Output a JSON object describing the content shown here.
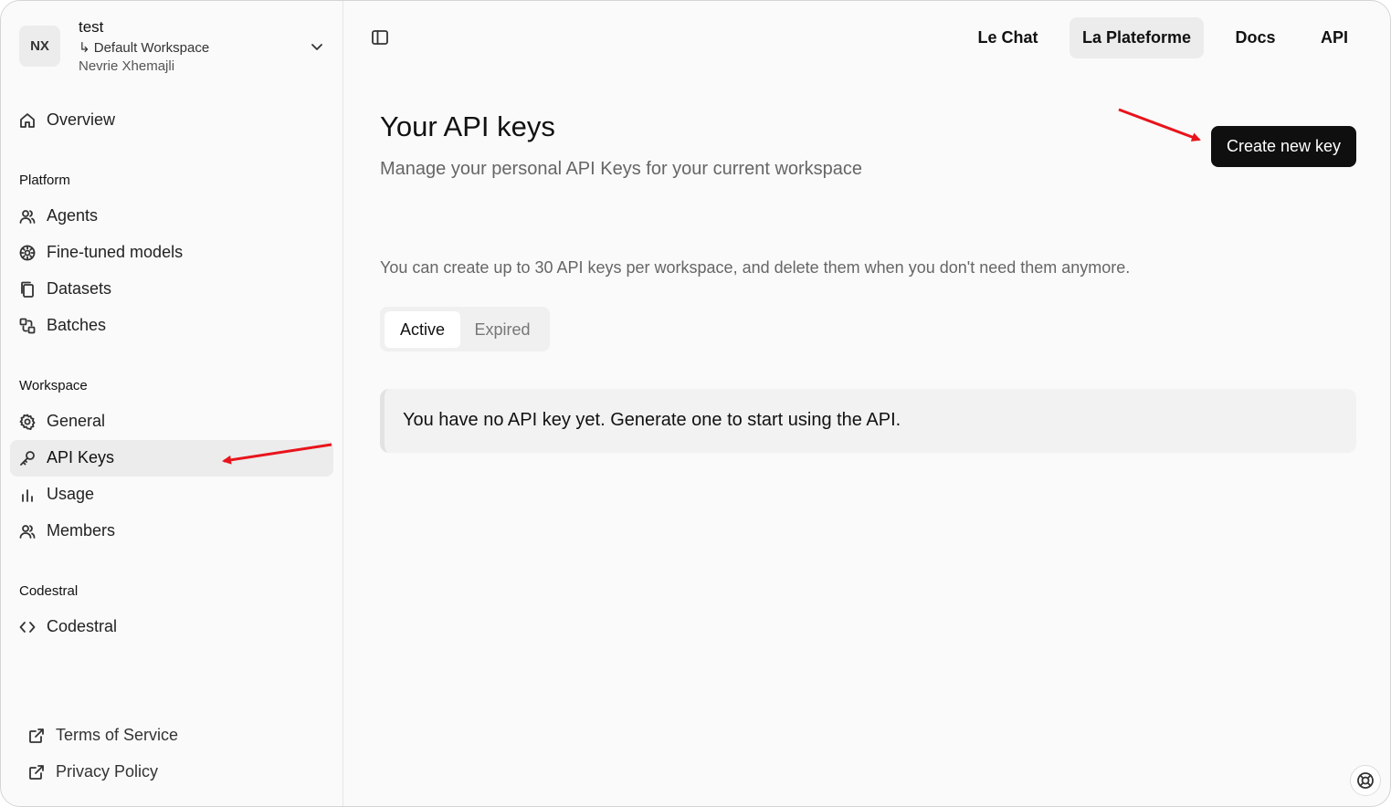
{
  "workspace": {
    "initials": "NX",
    "name": "test",
    "subtitle": "↳ Default Workspace",
    "user": "Nevrie Xhemajli"
  },
  "sidebar": {
    "overview": "Overview",
    "platform_label": "Platform",
    "platform_items": [
      "Agents",
      "Fine-tuned models",
      "Datasets",
      "Batches"
    ],
    "workspace_label": "Workspace",
    "workspace_items": [
      "General",
      "API Keys",
      "Usage",
      "Members"
    ],
    "codestral_label": "Codestral",
    "codestral_items": [
      "Codestral"
    ],
    "footer_items": [
      "Terms of Service",
      "Privacy Policy"
    ],
    "active_item": "API Keys"
  },
  "topnav": {
    "items": [
      "Le Chat",
      "La Plateforme",
      "Docs",
      "API"
    ],
    "active": "La Plateforme"
  },
  "main": {
    "title": "Your API keys",
    "subtitle": "Manage your personal API Keys for your current workspace",
    "create_button": "Create new key",
    "info": "You can create up to 30 API keys per workspace, and delete them when you don't need them anymore.",
    "tabs": [
      "Active",
      "Expired"
    ],
    "active_tab": "Active",
    "empty_message": "You have no API key yet. Generate one to start using the API."
  },
  "colors": {
    "annotation_arrow": "#e8141c",
    "primary_button": "#0f0f10"
  }
}
